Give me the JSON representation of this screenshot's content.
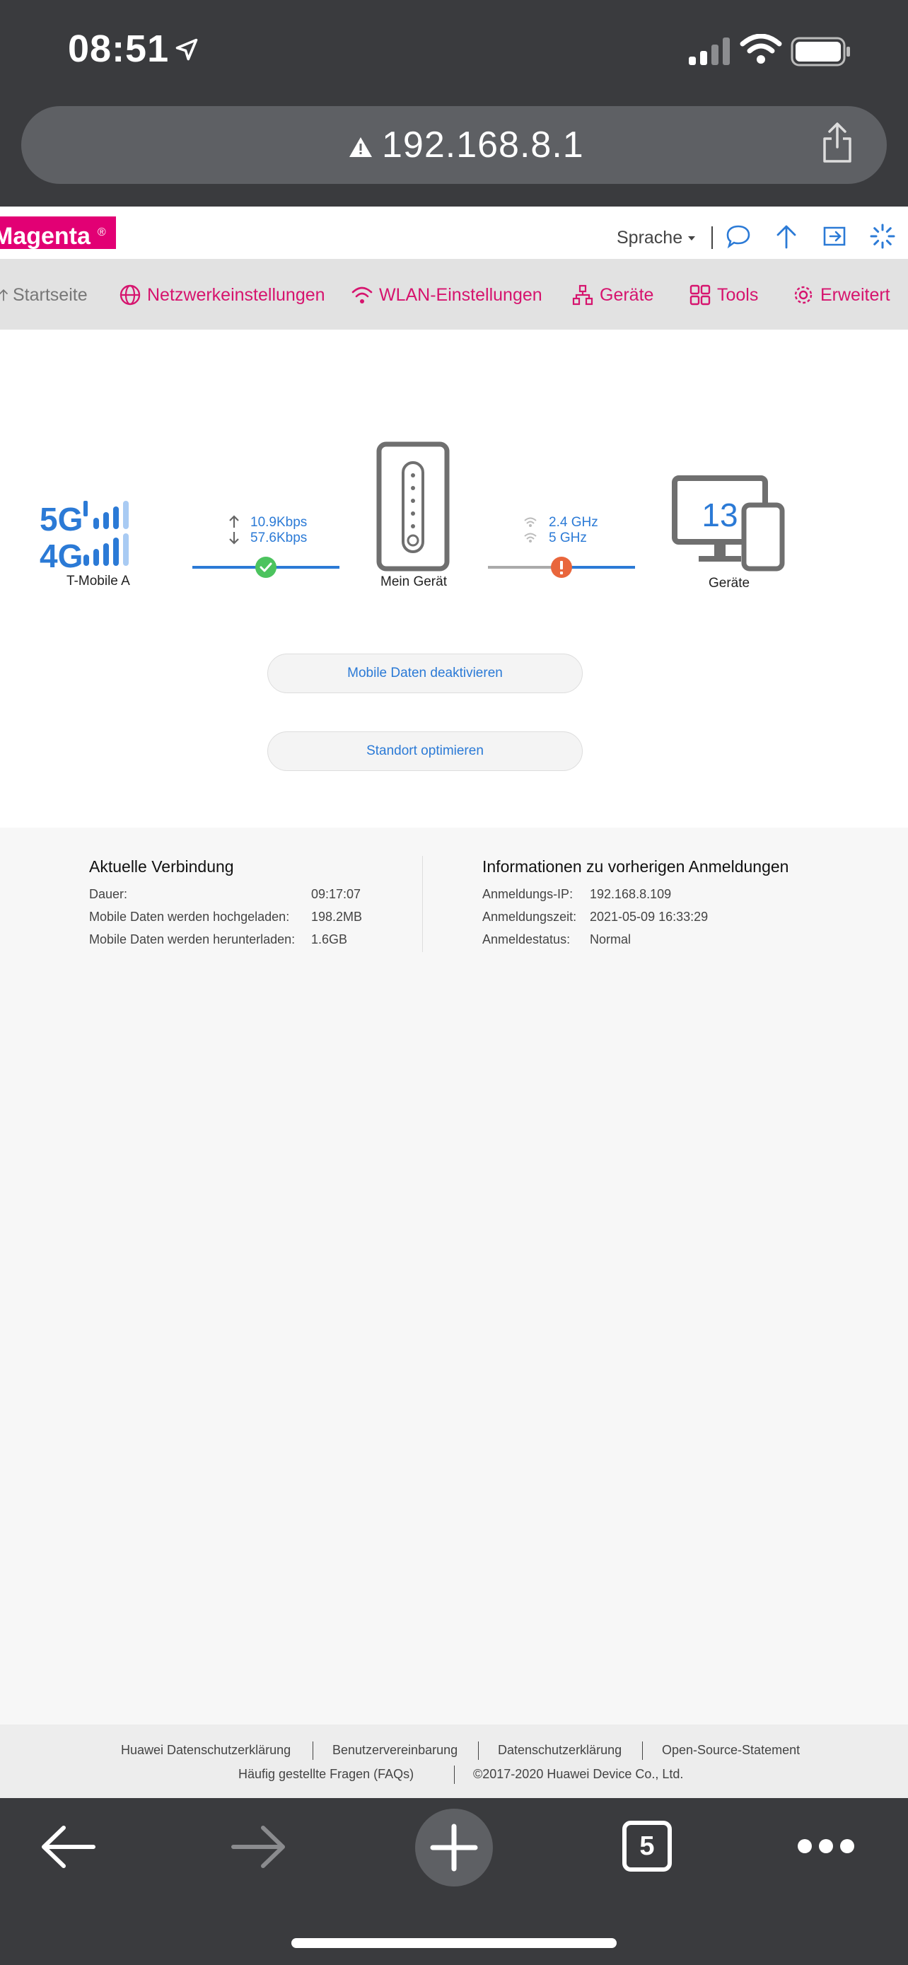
{
  "status_bar": {
    "time": "08:51"
  },
  "browser": {
    "url": "192.168.8.1",
    "tab_count": "5"
  },
  "header": {
    "logo": "Magenta",
    "language": "Sprache"
  },
  "nav": {
    "items": [
      {
        "label": "Startseite"
      },
      {
        "label": "Netzwerkeinstellungen"
      },
      {
        "label": "WLAN-Einstellungen"
      },
      {
        "label": "Geräte"
      },
      {
        "label": "Tools"
      },
      {
        "label": "Erweitert"
      }
    ]
  },
  "status": {
    "network_name": "T-Mobile A",
    "upload_rate": "10.9Kbps",
    "download_rate": "57.6Kbps",
    "device_label": "Mein Gerät",
    "band_24": "2.4 GHz",
    "band_5": "5 GHz",
    "device_count": "13",
    "devices_label": "Geräte",
    "net_5g": "5G",
    "net_4g": "4G"
  },
  "actions": {
    "disable_mobile_data": "Mobile Daten deaktivieren",
    "optimize_location": "Standort optimieren"
  },
  "current_connection": {
    "title": "Aktuelle Verbindung",
    "rows": [
      {
        "label": "Dauer:",
        "value": "09:17:07"
      },
      {
        "label": "Mobile Daten werden hochgeladen:",
        "value": "198.2MB"
      },
      {
        "label": "Mobile Daten werden herunterladen:",
        "value": "1.6GB"
      }
    ]
  },
  "previous_login": {
    "title": "Informationen zu vorherigen Anmeldungen",
    "rows": [
      {
        "label": "Anmeldungs-IP:",
        "value": "192.168.8.109"
      },
      {
        "label": "Anmeldungszeit:",
        "value": "2021-05-09 16:33:29"
      },
      {
        "label": "Anmeldestatus:",
        "value": "Normal"
      }
    ]
  },
  "footer": {
    "links": [
      "Huawei Datenschutzerklärung",
      "Benutzervereinbarung",
      "Datenschutzerklärung",
      "Open-Source-Statement",
      "Häufig gestellte Fragen (FAQs)"
    ],
    "copyright": "©2017-2020 Huawei Device Co., Ltd."
  },
  "colors": {
    "magenta": "#e20074",
    "blue": "#2b7ad6",
    "ok": "#4cc35e",
    "warn": "#e9663c"
  }
}
